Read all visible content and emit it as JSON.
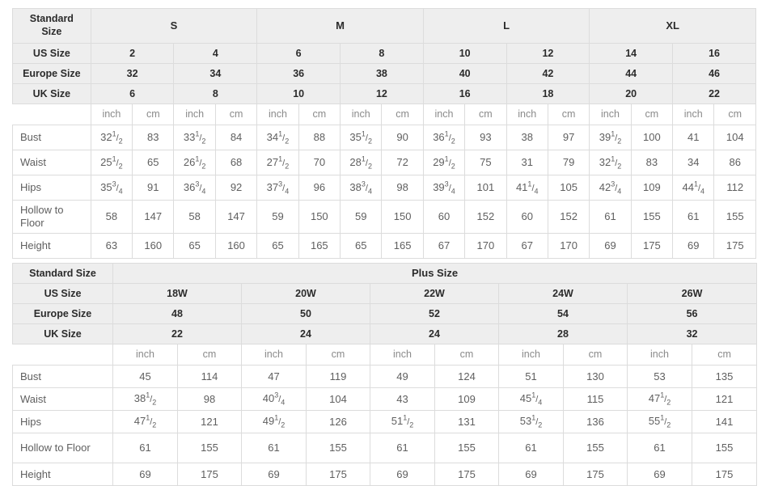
{
  "table1": {
    "corner_label": "Standard Size",
    "groups": [
      {
        "label": "S",
        "span": 4
      },
      {
        "label": "M",
        "span": 4
      },
      {
        "label": "L",
        "span": 4
      },
      {
        "label": "XL",
        "span": 4
      }
    ],
    "rows_header": [
      {
        "label": "US Size",
        "values": [
          "2",
          "4",
          "6",
          "8",
          "10",
          "12",
          "14",
          "16"
        ]
      },
      {
        "label": "Europe Size",
        "values": [
          "32",
          "34",
          "36",
          "38",
          "40",
          "42",
          "44",
          "46"
        ]
      },
      {
        "label": "UK Size",
        "values": [
          "6",
          "8",
          "10",
          "12",
          "16",
          "18",
          "20",
          "22"
        ]
      }
    ],
    "unit_row": {
      "label": "",
      "units": [
        "inch",
        "cm",
        "inch",
        "cm",
        "inch",
        "cm",
        "inch",
        "cm",
        "inch",
        "cm",
        "inch",
        "cm",
        "inch",
        "cm",
        "inch",
        "cm"
      ]
    },
    "measure_rows": [
      {
        "label": "Bust",
        "two_line": false,
        "values": [
          {
            "whole": "32",
            "num": "1",
            "den": "2"
          },
          {
            "plain": "83"
          },
          {
            "whole": "33",
            "num": "1",
            "den": "2"
          },
          {
            "plain": "84"
          },
          {
            "whole": "34",
            "num": "1",
            "den": "2"
          },
          {
            "plain": "88"
          },
          {
            "whole": "35",
            "num": "1",
            "den": "2"
          },
          {
            "plain": "90"
          },
          {
            "whole": "36",
            "num": "1",
            "den": "2"
          },
          {
            "plain": "93"
          },
          {
            "plain": "38"
          },
          {
            "plain": "97"
          },
          {
            "whole": "39",
            "num": "1",
            "den": "2"
          },
          {
            "plain": "100"
          },
          {
            "plain": "41"
          },
          {
            "plain": "104"
          }
        ]
      },
      {
        "label": "Waist",
        "two_line": false,
        "values": [
          {
            "whole": "25",
            "num": "1",
            "den": "2"
          },
          {
            "plain": "65"
          },
          {
            "whole": "26",
            "num": "1",
            "den": "2"
          },
          {
            "plain": "68"
          },
          {
            "whole": "27",
            "num": "1",
            "den": "2"
          },
          {
            "plain": "70"
          },
          {
            "whole": "28",
            "num": "1",
            "den": "2"
          },
          {
            "plain": "72"
          },
          {
            "whole": "29",
            "num": "1",
            "den": "2"
          },
          {
            "plain": "75"
          },
          {
            "plain": "31"
          },
          {
            "plain": "79"
          },
          {
            "whole": "32",
            "num": "1",
            "den": "2"
          },
          {
            "plain": "83"
          },
          {
            "plain": "34"
          },
          {
            "plain": "86"
          }
        ]
      },
      {
        "label": "Hips",
        "two_line": false,
        "values": [
          {
            "whole": "35",
            "num": "3",
            "den": "4"
          },
          {
            "plain": "91"
          },
          {
            "whole": "36",
            "num": "3",
            "den": "4"
          },
          {
            "plain": "92"
          },
          {
            "whole": "37",
            "num": "3",
            "den": "4"
          },
          {
            "plain": "96"
          },
          {
            "whole": "38",
            "num": "3",
            "den": "4"
          },
          {
            "plain": "98"
          },
          {
            "whole": "39",
            "num": "3",
            "den": "4"
          },
          {
            "plain": "101"
          },
          {
            "whole": "41",
            "num": "1",
            "den": "4"
          },
          {
            "plain": "105"
          },
          {
            "whole": "42",
            "num": "3",
            "den": "4"
          },
          {
            "plain": "109"
          },
          {
            "whole": "44",
            "num": "1",
            "den": "4"
          },
          {
            "plain": "112"
          }
        ]
      },
      {
        "label": "Hollow to Floor",
        "two_line": true,
        "values": [
          {
            "plain": "58"
          },
          {
            "plain": "147"
          },
          {
            "plain": "58"
          },
          {
            "plain": "147"
          },
          {
            "plain": "59"
          },
          {
            "plain": "150"
          },
          {
            "plain": "59"
          },
          {
            "plain": "150"
          },
          {
            "plain": "60"
          },
          {
            "plain": "152"
          },
          {
            "plain": "60"
          },
          {
            "plain": "152"
          },
          {
            "plain": "61"
          },
          {
            "plain": "155"
          },
          {
            "plain": "61"
          },
          {
            "plain": "155"
          }
        ]
      },
      {
        "label": "Height",
        "two_line": false,
        "values": [
          {
            "plain": "63"
          },
          {
            "plain": "160"
          },
          {
            "plain": "65"
          },
          {
            "plain": "160"
          },
          {
            "plain": "65"
          },
          {
            "plain": "165"
          },
          {
            "plain": "65"
          },
          {
            "plain": "165"
          },
          {
            "plain": "67"
          },
          {
            "plain": "170"
          },
          {
            "plain": "67"
          },
          {
            "plain": "170"
          },
          {
            "plain": "69"
          },
          {
            "plain": "175"
          },
          {
            "plain": "69"
          },
          {
            "plain": "175"
          }
        ]
      }
    ]
  },
  "table2": {
    "corner_label": "Standard Size",
    "group_label": "Plus Size",
    "rows_header": [
      {
        "label": "US Size",
        "values": [
          "18W",
          "20W",
          "22W",
          "24W",
          "26W"
        ]
      },
      {
        "label": "Europe Size",
        "values": [
          "48",
          "50",
          "52",
          "54",
          "56"
        ]
      },
      {
        "label": "UK Size",
        "values": [
          "22",
          "24",
          "24",
          "28",
          "32"
        ]
      }
    ],
    "unit_row": {
      "label": "",
      "units": [
        "inch",
        "cm",
        "inch",
        "cm",
        "inch",
        "cm",
        "inch",
        "cm",
        "inch",
        "cm"
      ]
    },
    "measure_rows": [
      {
        "label": "Bust",
        "values": [
          {
            "plain": "45"
          },
          {
            "plain": "114"
          },
          {
            "plain": "47"
          },
          {
            "plain": "119"
          },
          {
            "plain": "49"
          },
          {
            "plain": "124"
          },
          {
            "plain": "51"
          },
          {
            "plain": "130"
          },
          {
            "plain": "53"
          },
          {
            "plain": "135"
          }
        ]
      },
      {
        "label": "Waist",
        "values": [
          {
            "whole": "38",
            "num": "1",
            "den": "2"
          },
          {
            "plain": "98"
          },
          {
            "whole": "40",
            "num": "3",
            "den": "4"
          },
          {
            "plain": "104"
          },
          {
            "plain": "43"
          },
          {
            "plain": "109"
          },
          {
            "whole": "45",
            "num": "1",
            "den": "4"
          },
          {
            "plain": "115"
          },
          {
            "whole": "47",
            "num": "1",
            "den": "2"
          },
          {
            "plain": "121"
          }
        ]
      },
      {
        "label": "Hips",
        "values": [
          {
            "whole": "47",
            "num": "1",
            "den": "2"
          },
          {
            "plain": "121"
          },
          {
            "whole": "49",
            "num": "1",
            "den": "2"
          },
          {
            "plain": "126"
          },
          {
            "whole": "51",
            "num": "1",
            "den": "2"
          },
          {
            "plain": "131"
          },
          {
            "whole": "53",
            "num": "1",
            "den": "2"
          },
          {
            "plain": "136"
          },
          {
            "whole": "55",
            "num": "1",
            "den": "2"
          },
          {
            "plain": "141"
          }
        ]
      },
      {
        "label": "Hollow to Floor",
        "values": [
          {
            "plain": "61"
          },
          {
            "plain": "155"
          },
          {
            "plain": "61"
          },
          {
            "plain": "155"
          },
          {
            "plain": "61"
          },
          {
            "plain": "155"
          },
          {
            "plain": "61"
          },
          {
            "plain": "155"
          },
          {
            "plain": "61"
          },
          {
            "plain": "155"
          }
        ]
      },
      {
        "label": "Height",
        "values": [
          {
            "plain": "69"
          },
          {
            "plain": "175"
          },
          {
            "plain": "69"
          },
          {
            "plain": "175"
          },
          {
            "plain": "69"
          },
          {
            "plain": "175"
          },
          {
            "plain": "69"
          },
          {
            "plain": "175"
          },
          {
            "plain": "69"
          },
          {
            "plain": "175"
          }
        ]
      }
    ]
  },
  "colors": {
    "header_bg": "#eeeeee",
    "border": "#dcdcdc",
    "header_text": "#2b2b2b",
    "body_text": "#5f5f5f",
    "unit_text": "#8a8a8a"
  }
}
